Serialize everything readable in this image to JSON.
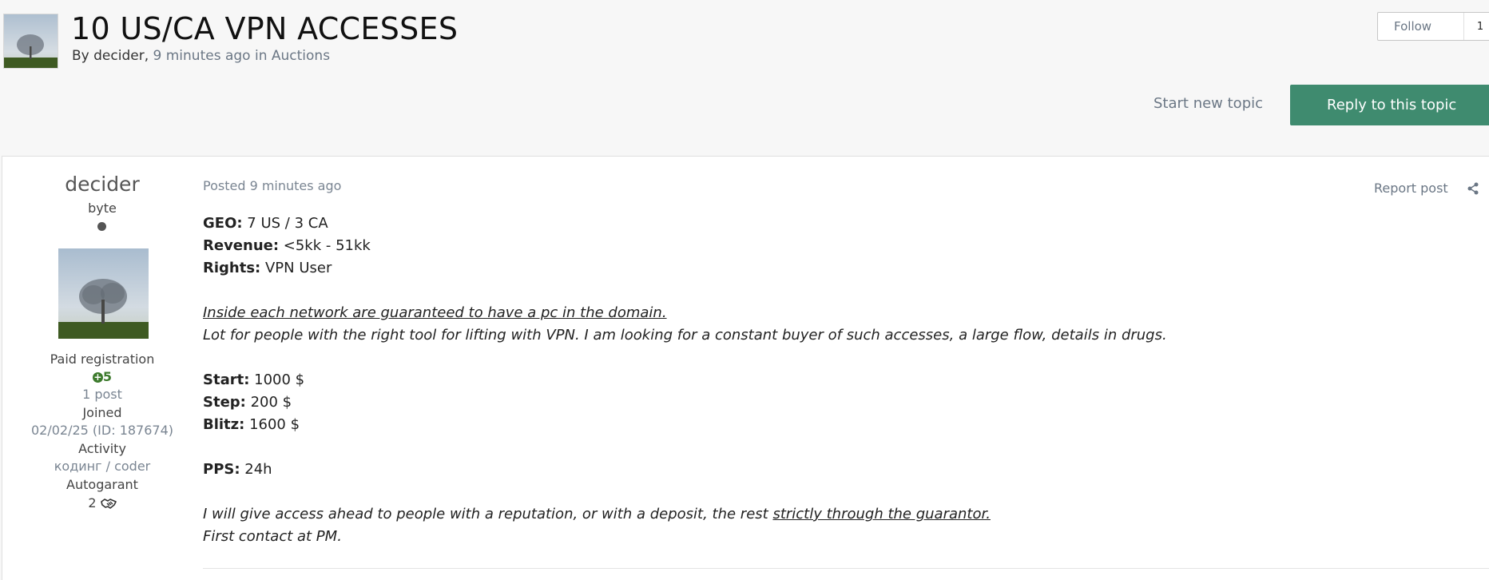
{
  "topic": {
    "title": "10 US/CA VPN ACCESSES",
    "by_label": "By",
    "author": "decider",
    "comma": ",",
    "time": "9 minutes ago",
    "in_label": "in",
    "forum": "Auctions"
  },
  "follow": {
    "label": "Follow",
    "count": "1"
  },
  "actions": {
    "start_new_topic": "Start new topic",
    "reply": "Reply to this topic"
  },
  "author_panel": {
    "name": "decider",
    "rank": "byte",
    "group": "Paid registration",
    "reputation": "5",
    "posts": "1 post",
    "joined_label": "Joined",
    "joined_value": "02/02/25 (ID: 187674)",
    "activity_label": "Activity",
    "activity_value": "кодинг / coder",
    "autogarant_label": "Autogarant",
    "autogarant_value": "2"
  },
  "post": {
    "posted": "Posted 9 minutes ago",
    "report": "Report post",
    "geo_label": "GEO:",
    "geo_value": " 7 US / 3 CA",
    "revenue_label": "Revenue:",
    "revenue_value": " <5kk - 51kk",
    "rights_label": "Rights:",
    "rights_value": " VPN User",
    "guarantee_line": "Inside each network are guaranteed to have a pc in the domain.",
    "lot_line": "Lot for people with the right tool for lifting with VPN. I am looking for a constant buyer of such accesses, a large flow, details in drugs.",
    "start_label": "Start:",
    "start_value": " 1000 $",
    "step_label": "Step:",
    "step_value": " 200 $",
    "blitz_label": "Blitz:",
    "blitz_value": " 1600 $",
    "pps_label": "PPS:",
    "pps_value": " 24h",
    "access_line_part1": "I will give access ahead to people with a reputation, or with a deposit, the rest ",
    "access_line_part2": "strictly through the guarantor.",
    "contact_line": "First contact at PM."
  },
  "colors": {
    "accent_green": "#3f8b6f",
    "reputation_green": "#3c7a2c",
    "muted_text": "#6b7785"
  },
  "icons": {
    "share": "share-icon",
    "reputation": "plus-circle-icon",
    "autogarant": "handshake-icon",
    "status": "offline-dot-icon"
  }
}
